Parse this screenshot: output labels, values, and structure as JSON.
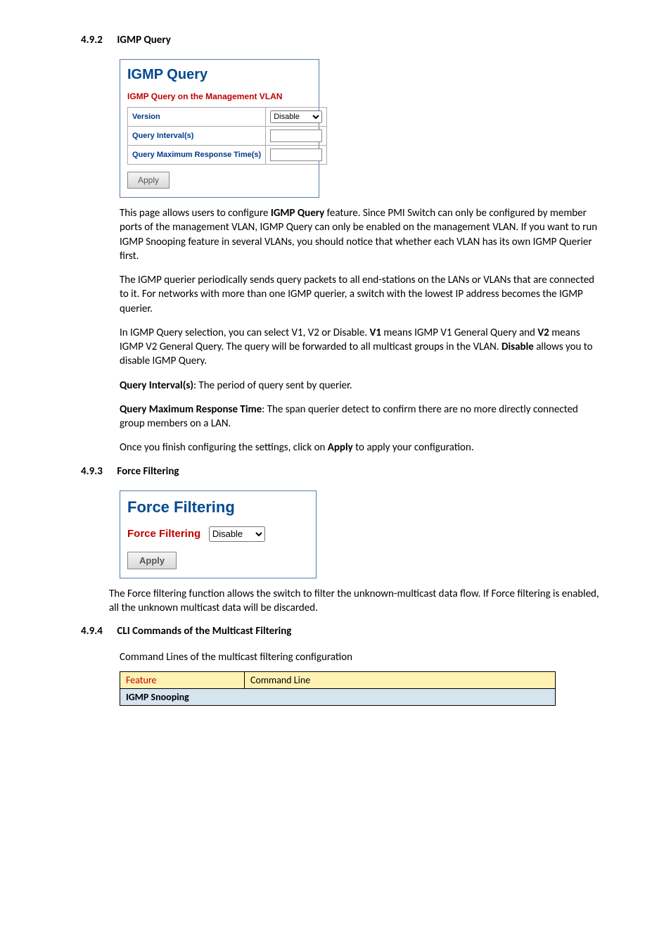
{
  "sec492": {
    "num": "4.9.2",
    "title": "IGMP Query"
  },
  "igmp": {
    "panel_title": "IGMP Query",
    "sub_title": "IGMP Query on the Management VLAN",
    "row_version": "Version",
    "row_interval": "Query Interval(s)",
    "row_maxresp": "Query Maximum Response Time(s)",
    "version_value": "Disable",
    "interval_value": "",
    "maxresp_value": "",
    "apply_label": "Apply"
  },
  "para1a": "This page allows users to configure ",
  "para1b": "IGMP Query",
  "para1c": " feature. Since PMI Switch can only be configured by member ports of the management VLAN, IGMP Query can only be enabled on the management VLAN. If you want to run IGMP Snooping feature in several VLANs, you should notice that whether each VLAN has its own IGMP Querier first.",
  "para2": "The IGMP querier periodically sends query packets to all end-stations on the LANs or VLANs that are connected to it. For networks with more than one IGMP querier, a switch with the lowest IP address becomes the IGMP querier.",
  "para3a": "In IGMP Query selection, you can select V1, V2 or Disable. ",
  "para3b": "V1",
  "para3c": " means IGMP V1 General Query and ",
  "para3d": "V2",
  "para3e": " means IGMP V2 General Query. The query will be forwarded to all multicast groups in the VLAN. ",
  "para3f": "Disable",
  "para3g": " allows you to disable IGMP Query.",
  "para4a": "Query Interval(s)",
  "para4b": ": The period of query sent by querier.",
  "para5a": "Query Maximum Response Time",
  "para5b": ": The span querier detect to confirm there are no more directly connected group members on a LAN.",
  "para6a": "Once you finish configuring the settings, click on ",
  "para6b": "Apply",
  "para6c": " to apply your configuration.",
  "sec493": {
    "num": "4.9.3",
    "title": "Force Filtering"
  },
  "ff": {
    "title": "Force Filtering",
    "label": "Force Filtering",
    "value": "Disable",
    "apply": "Apply"
  },
  "para7": "The Force filtering function allows the switch to filter the unknown-multicast data flow. If Force filtering is enabled, all the unknown multicast data will be discarded.",
  "sec494": {
    "num": "4.9.4",
    "title": "CLI Commands of the Multicast Filtering"
  },
  "para8": "Command Lines of the multicast filtering configuration",
  "cmdtable": {
    "head_feature": "Feature",
    "head_cmd": "Command Line",
    "row_snooping": "IGMP Snooping"
  }
}
